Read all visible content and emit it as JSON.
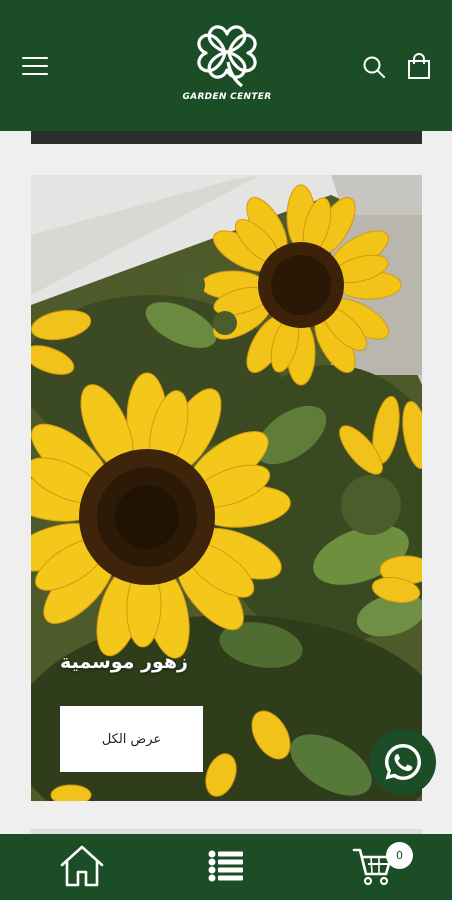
{
  "header": {
    "logo_text": "GARDEN CENTER",
    "menu_icon": "hamburger-menu-icon",
    "search_icon": "search-icon",
    "bag_icon": "shopping-bag-icon"
  },
  "banner": {
    "title": "زهور موسمية",
    "button_label": "عرض الكل",
    "image_subject": "sunflowers"
  },
  "whatsapp": {
    "icon": "whatsapp-icon"
  },
  "bottom_nav": {
    "home_icon": "home-icon",
    "menu_icon": "list-menu-icon",
    "cart_icon": "cart-icon",
    "cart_count": "0"
  },
  "colors": {
    "brand_green": "#1b4d27",
    "background": "#efefef",
    "sunflower_yellow": "#f2c418"
  }
}
